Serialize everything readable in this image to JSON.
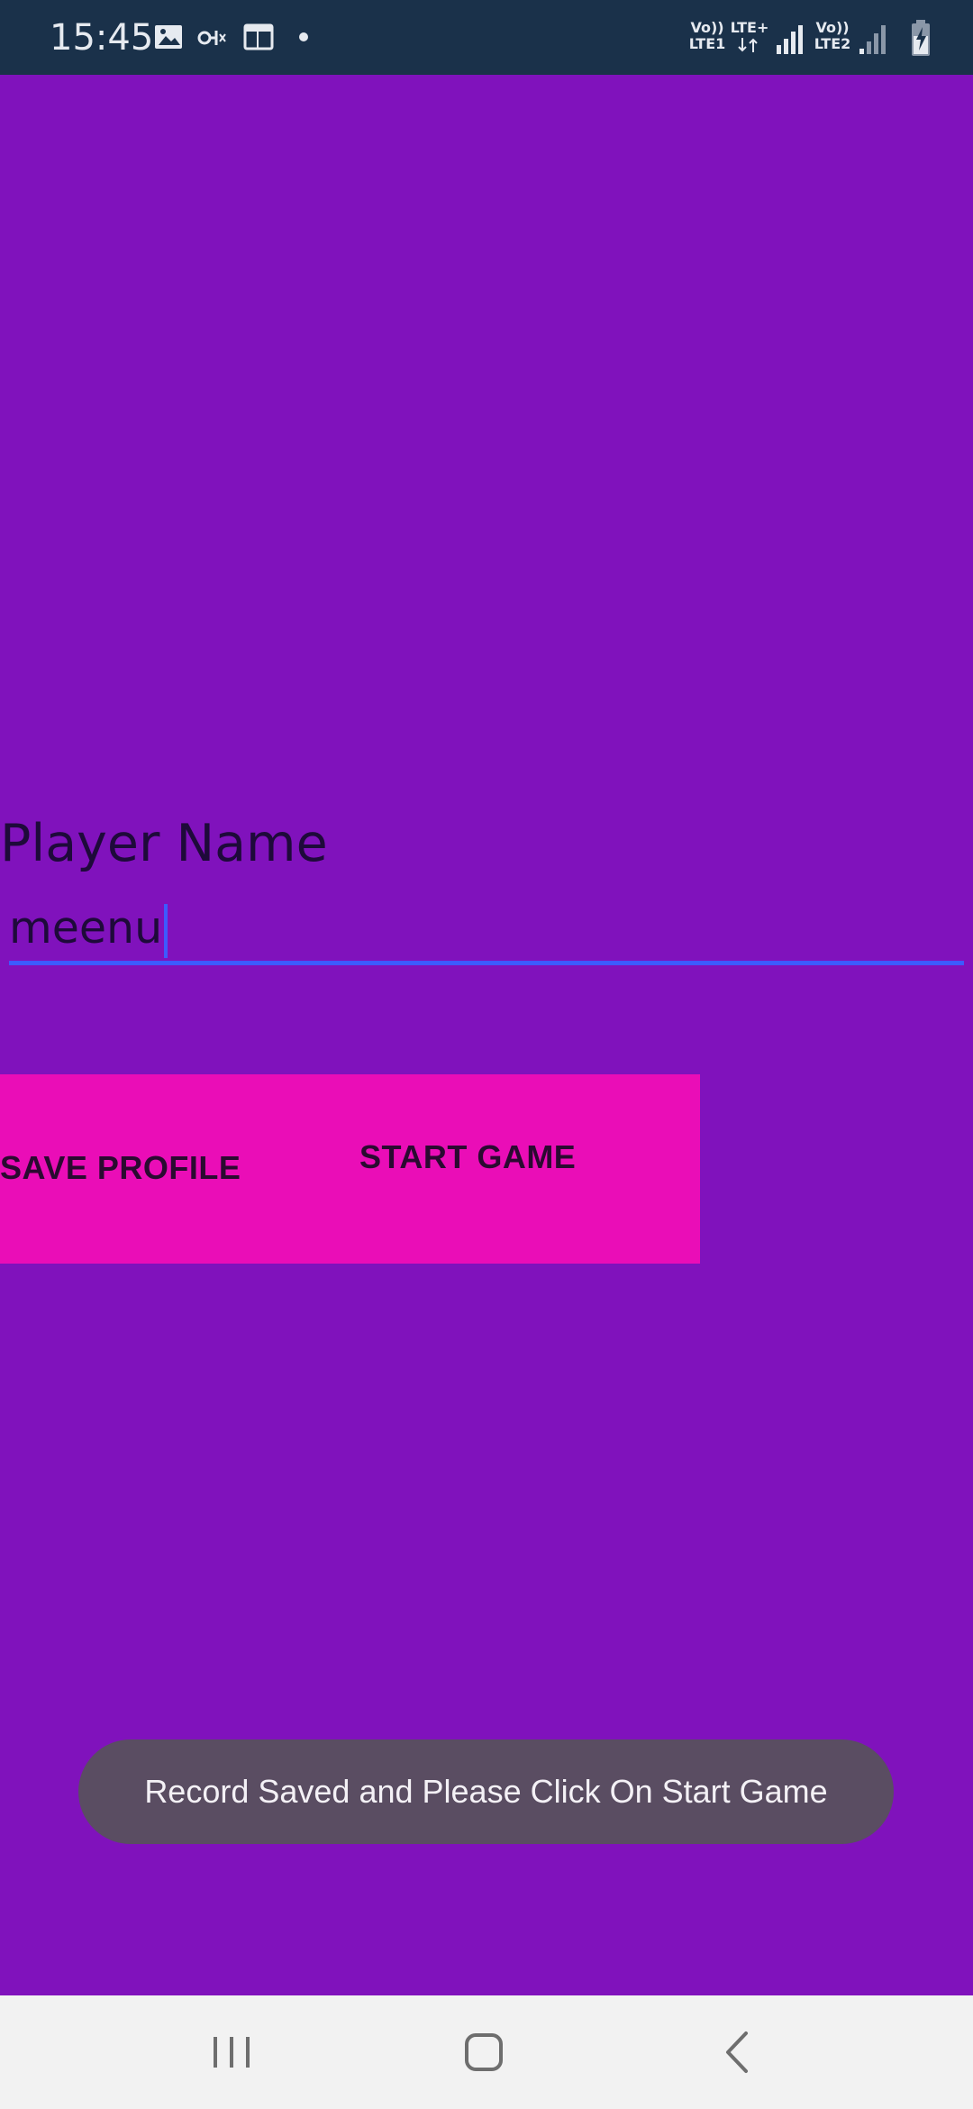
{
  "status_bar": {
    "time": "15:45",
    "left_icons": [
      "image-icon",
      "voicemail-icon",
      "calendar-icon",
      "dot-icon"
    ],
    "sim1": {
      "top": "Vo))",
      "bottom": "LTE1",
      "net": "LTE+"
    },
    "sim2": {
      "top": "Vo))",
      "bottom": "LTE2"
    },
    "right_icons": [
      "signal-icon",
      "signal-icon",
      "battery-charging-icon"
    ]
  },
  "form": {
    "label": "Player Name",
    "name_value": "meenu"
  },
  "buttons": {
    "save_label": "SAVE PROFILE",
    "start_label": "START GAME"
  },
  "toast": {
    "message": "Record Saved and Please Click On Start Game"
  },
  "nav_bar": {
    "icons": [
      "recents-icon",
      "home-icon",
      "back-icon"
    ]
  },
  "colors": {
    "background": "#8012BC",
    "button_panel": "#EA0DB7",
    "accent": "#3D5AFE",
    "toast": "#5A4D62",
    "status_bar": "#1A314A"
  }
}
